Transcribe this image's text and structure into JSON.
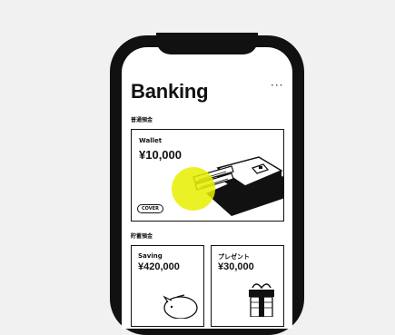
{
  "app": {
    "title": "Banking",
    "menu_icon": "ellipsis-icon"
  },
  "sections": [
    {
      "label": "普通預金"
    },
    {
      "label": "貯蓄預金"
    }
  ],
  "wallet_card": {
    "name": "Wallet",
    "amount": "¥10,000",
    "cover_label": "COVER",
    "accent_color": "#e6f000"
  },
  "saving_cards": [
    {
      "name": "Saving",
      "amount": "¥420,000",
      "icon": "piggy-bank-icon"
    },
    {
      "name": "プレゼント",
      "amount": "¥30,000",
      "icon": "gift-box-icon"
    }
  ]
}
